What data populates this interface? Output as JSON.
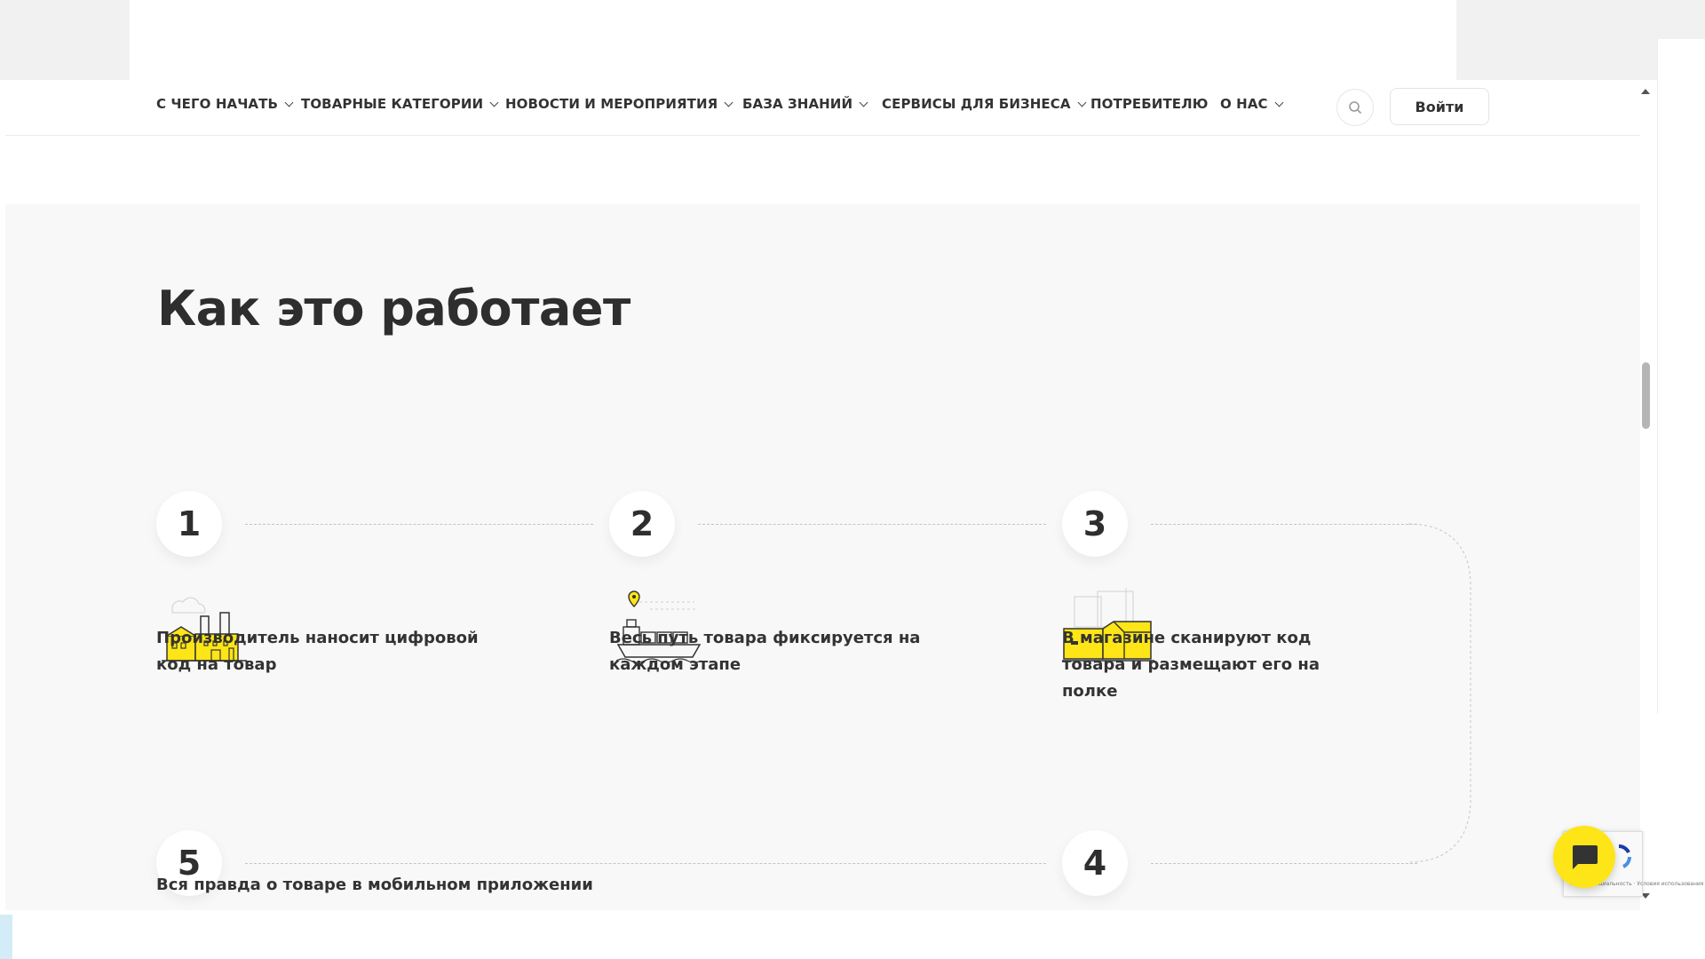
{
  "nav": {
    "items": [
      {
        "label": "С ЧЕГО НАЧАТЬ",
        "has_dropdown": true
      },
      {
        "label": "ТОВАРНЫЕ КАТЕГОРИИ",
        "has_dropdown": true
      },
      {
        "label": "НОВОСТИ И МЕРОПРИЯТИЯ",
        "has_dropdown": true
      },
      {
        "label": "БАЗА ЗНАНИЙ",
        "has_dropdown": true
      },
      {
        "label": "СЕРВИСЫ ДЛЯ БИЗНЕСА",
        "has_dropdown": true
      },
      {
        "label": "ПОТРЕБИТЕЛЮ",
        "has_dropdown": false
      },
      {
        "label": "О НАС",
        "has_dropdown": true
      }
    ],
    "search_icon": "search-icon",
    "login_label": "Войти"
  },
  "section": {
    "title": "Как это работает",
    "steps": [
      {
        "number": "1",
        "text": "Производитель наносит цифровой код на товар",
        "icon": "factory-icon"
      },
      {
        "number": "2",
        "text": "Весь путь товара фиксируется на каждом этапе",
        "icon": "ship-icon"
      },
      {
        "number": "3",
        "text": "В магазине сканируют код товара и размещают его на полке",
        "icon": "boxes-icon"
      },
      {
        "number": "4",
        "text": "",
        "icon": "shopping-bag-icon"
      },
      {
        "number": "5",
        "text": "Вся правда о товаре в мобильном приложении",
        "icon": ""
      }
    ]
  },
  "colors": {
    "accent": "#fde517",
    "text": "#2e2e2e",
    "section_bg": "#f8f8f8",
    "dashed_line": "#c4c4c4"
  },
  "widgets": {
    "chat_icon": "chat-icon",
    "recaptcha_text": "Конфиденциальность · Условия использования"
  }
}
